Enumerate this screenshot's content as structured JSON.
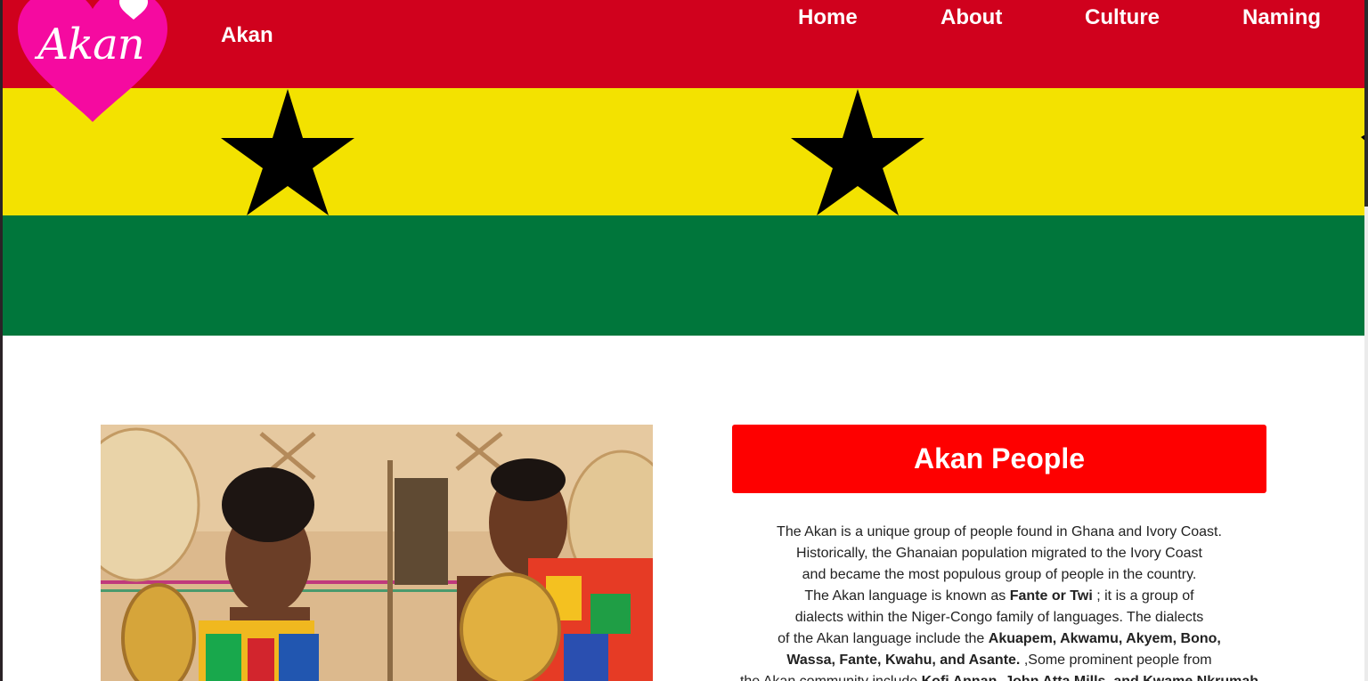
{
  "site": {
    "logo_text": "Akan",
    "brand": "Akan"
  },
  "nav": {
    "items": [
      "Home",
      "About",
      "Culture",
      "Naming"
    ]
  },
  "colors": {
    "flag_red": "#d0011d",
    "flag_yellow": "#f3e200",
    "flag_green": "#00763b",
    "heading_box": "#fe0000",
    "logo_pink": "#f50aa0"
  },
  "banner": {
    "description_icons": [
      "star-icon",
      "star-icon"
    ]
  },
  "intro": {
    "heading": "Akan People",
    "lines": [
      [
        {
          "t": "The Akan is a unique group of people found in Ghana and Ivory Coast.",
          "b": false
        }
      ],
      [
        {
          "t": "Historically, the Ghanaian population migrated to the Ivory Coast",
          "b": false
        }
      ],
      [
        {
          "t": "and became the most populous group of people in the country.",
          "b": false
        }
      ],
      [
        {
          "t": "The Akan language is known as ",
          "b": false
        },
        {
          "t": "Fante or Twi",
          "b": true
        },
        {
          "t": " ; it is a group of",
          "b": false
        }
      ],
      [
        {
          "t": "dialects within the Niger-Congo family of languages. The dialects",
          "b": false
        }
      ],
      [
        {
          "t": "of the Akan language include the ",
          "b": false
        },
        {
          "t": "Akuapem, Akwamu, Akyem, Bono,",
          "b": true
        }
      ],
      [
        {
          "t": "Wassa, Fante, Kwahu, and Asante.",
          "b": true
        },
        {
          "t": " ,Some prominent people from",
          "b": false
        }
      ],
      [
        {
          "t": "the Akan community include ",
          "b": false
        },
        {
          "t": "Kofi Annan, John Atta Mills, and Kwame Nkrumah",
          "b": true
        }
      ]
    ]
  }
}
